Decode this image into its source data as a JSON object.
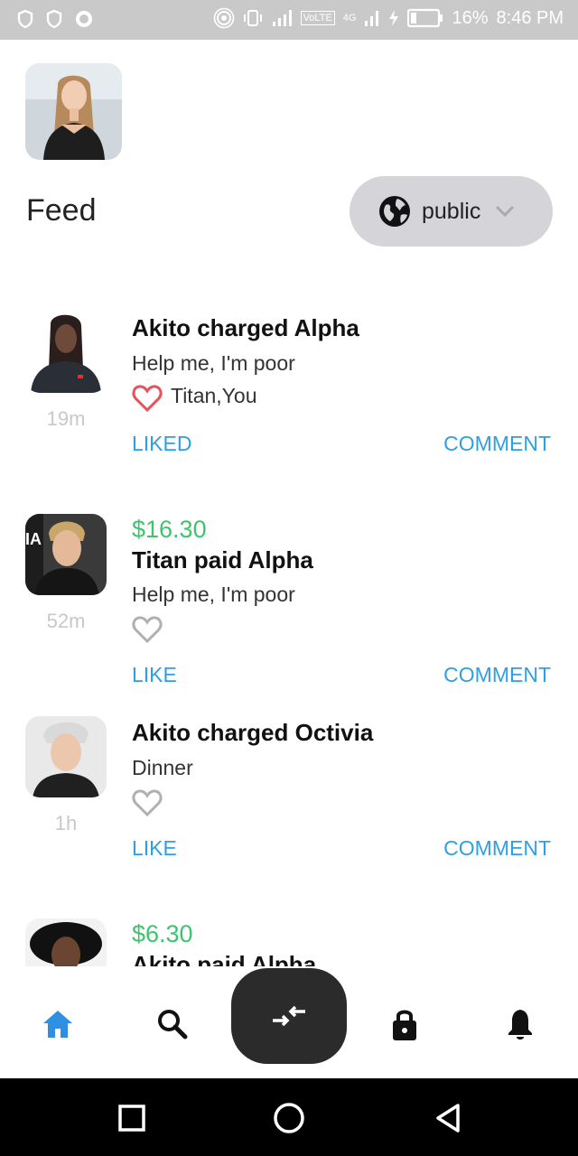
{
  "status_bar": {
    "battery": "16%",
    "time": "8:46 PM",
    "network": "VoLTE",
    "network_gen": "4G"
  },
  "header": {
    "title": "Feed",
    "visibility": "public"
  },
  "feed": [
    {
      "amount": "",
      "title": "Akito charged Alpha",
      "note": "Help me, I'm poor",
      "time": "19m",
      "liked": true,
      "likers": "Titan,You",
      "like_label": "LIKED",
      "comment_label": "COMMENT"
    },
    {
      "amount": "$16.30",
      "title": "Titan paid Alpha",
      "note": "Help me, I'm poor",
      "time": "52m",
      "liked": false,
      "likers": "",
      "like_label": "LIKE",
      "comment_label": "COMMENT"
    },
    {
      "amount": "",
      "title": "Akito charged Octivia",
      "note": "Dinner",
      "time": "1h",
      "liked": false,
      "likers": "",
      "like_label": "LIKE",
      "comment_label": "COMMENT"
    },
    {
      "amount": "$6.30",
      "title": "Akito paid Alpha",
      "note": "",
      "time": "",
      "liked": false,
      "likers": "",
      "like_label": "",
      "comment_label": ""
    }
  ],
  "nav": {
    "items": [
      "home-icon",
      "search-icon",
      "transfer-icon",
      "lock-icon",
      "bell-icon"
    ],
    "active": "home-icon"
  },
  "colors": {
    "accent": "#2f9fe3",
    "amount": "#3ec46d",
    "heart_liked": "#e8505b",
    "heart_idle": "#b0b0b0",
    "fab": "#2b2b2b"
  }
}
